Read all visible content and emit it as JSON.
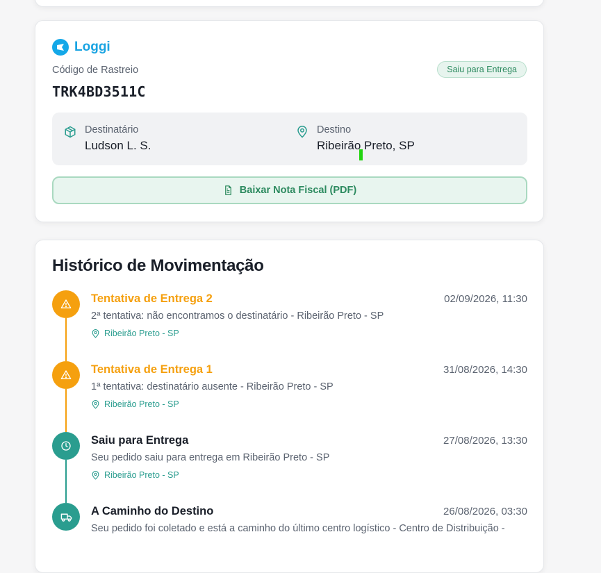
{
  "shipment": {
    "carrier": "Loggi",
    "tracking_label": "Código de Rastreio",
    "tracking_code": "TRK4BD3511C",
    "status_badge": "Saiu para Entrega",
    "recipient_label": "Destinatário",
    "recipient_value": "Ludson L. S.",
    "destination_label": "Destino",
    "destination_value": "Ribeirão Preto, SP",
    "pdf_button": "Baixar Nota Fiscal (PDF)"
  },
  "history": {
    "title": "Histórico de Movimentação",
    "events": [
      {
        "title": "Tentativa de Entrega 2",
        "date": "02/09/2026, 11:30",
        "description": "2ª tentativa: não encontramos o destinatário - Ribeirão Preto - SP",
        "location": "Ribeirão Preto - SP",
        "icon": "alert-triangle-icon",
        "color": "#f5a00f"
      },
      {
        "title": "Tentativa de Entrega 1",
        "date": "31/08/2026, 14:30",
        "description": "1ª tentativa: destinatário ausente - Ribeirão Preto - SP",
        "location": "Ribeirão Preto - SP",
        "icon": "alert-triangle-icon",
        "color": "#f5a00f"
      },
      {
        "title": "Saiu para Entrega",
        "date": "27/08/2026, 13:30",
        "description": "Seu pedido saiu para entrega em Ribeirão Preto - SP",
        "location": "Ribeirão Preto - SP",
        "icon": "clock-icon",
        "color": "#2a9d8f"
      },
      {
        "title": "A Caminho do Destino",
        "date": "26/08/2026, 03:30",
        "description": "Seu pedido foi coletado e está a caminho do último centro logístico - Centro de Distribuição -",
        "location": "",
        "icon": "truck-icon",
        "color": "#2a9d8f"
      }
    ]
  },
  "colors": {
    "accent_teal": "#2a9d8f",
    "warning_orange": "#f5a00f",
    "success_green": "#2c8a5f",
    "carrier_blue": "#1aa4e2"
  }
}
